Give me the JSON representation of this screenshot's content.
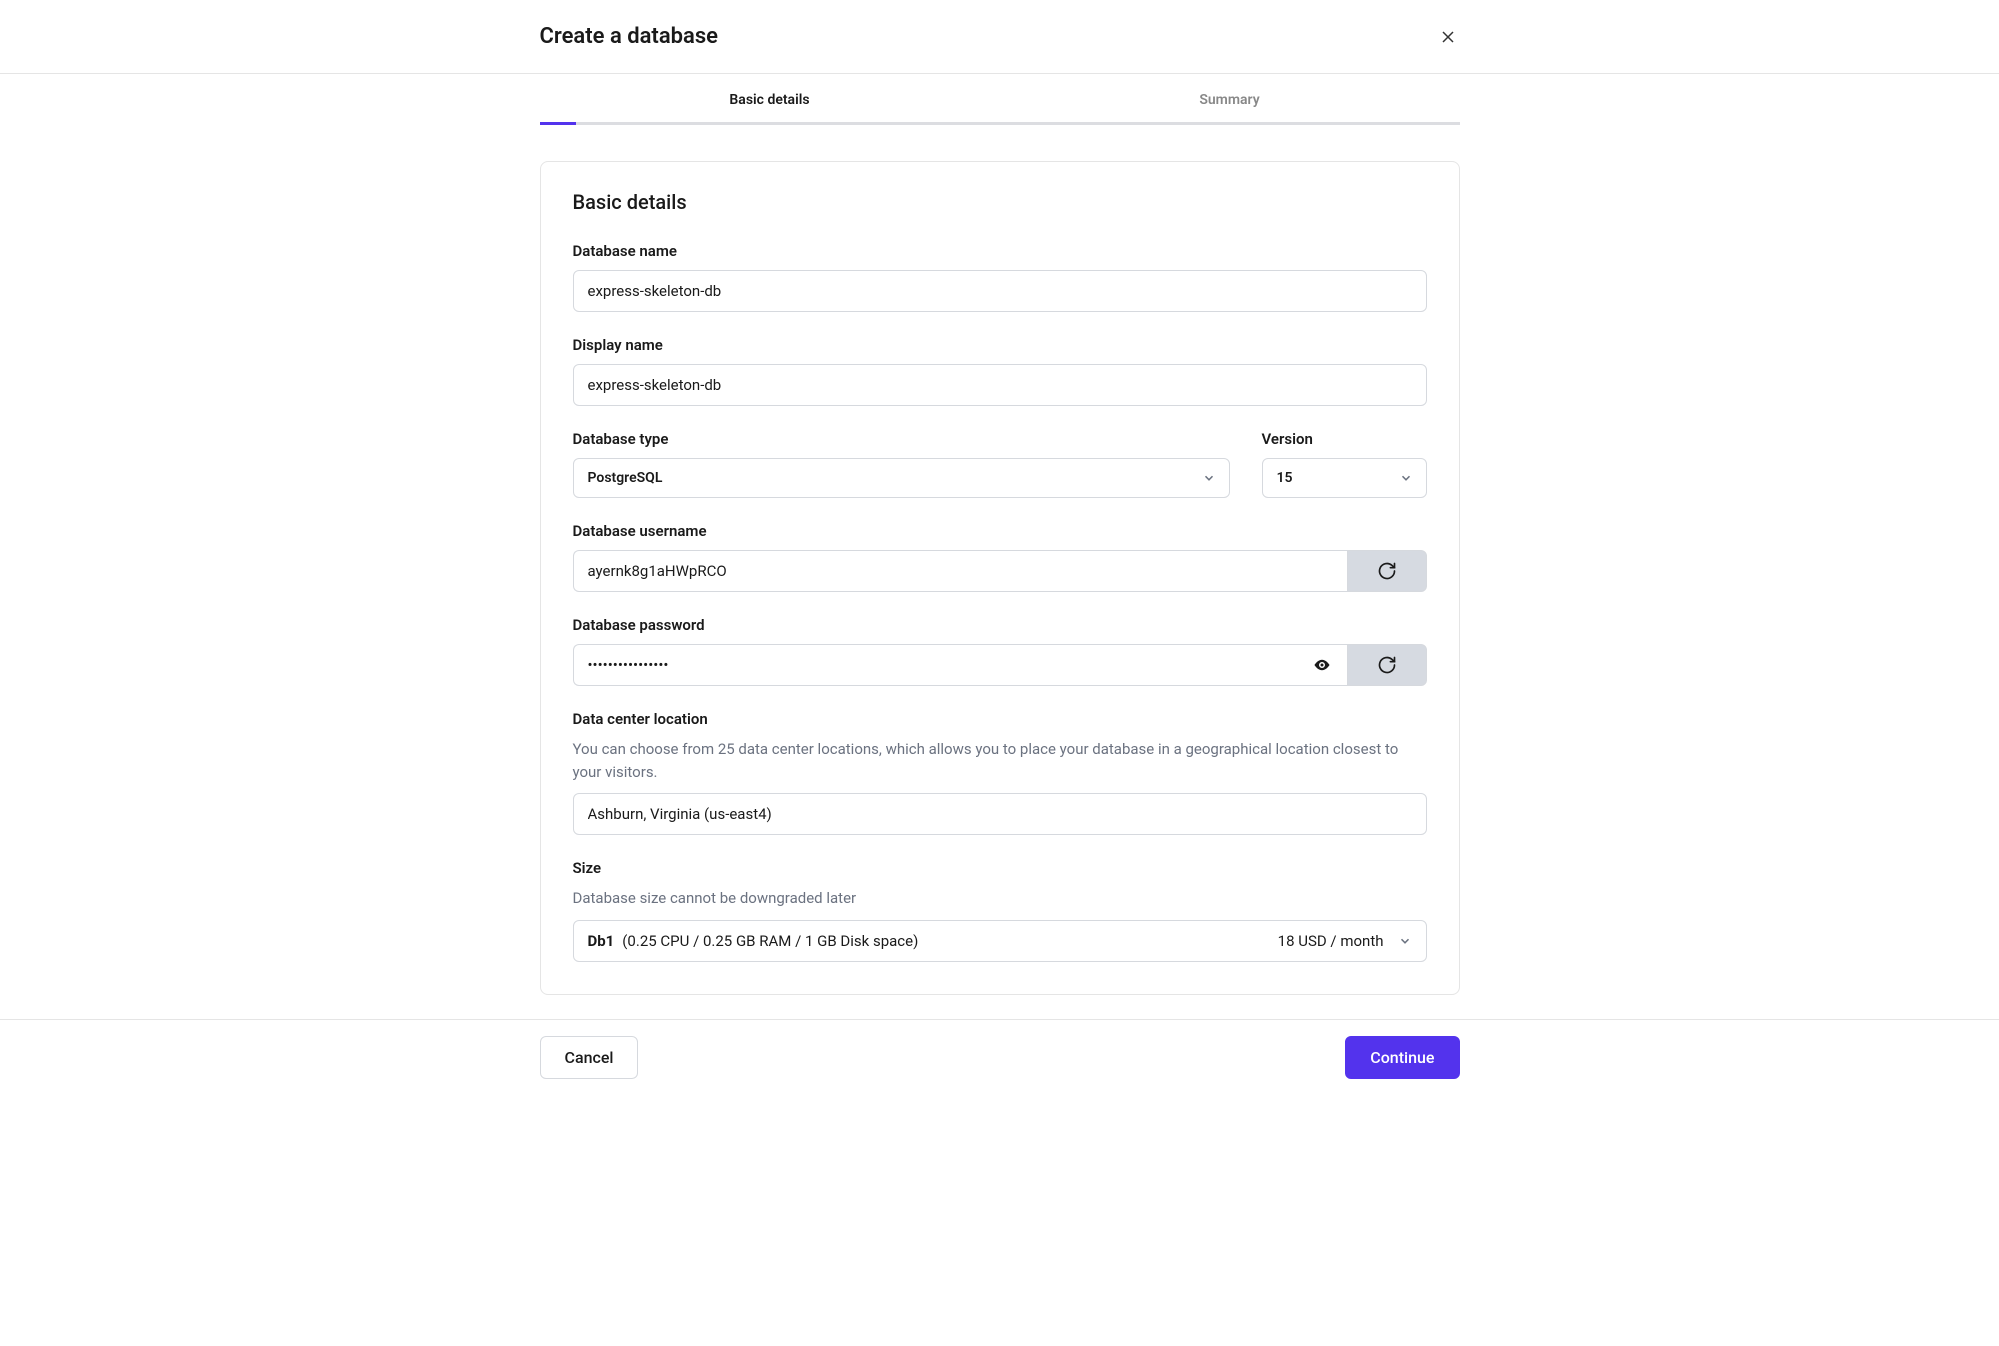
{
  "header": {
    "title": "Create a database"
  },
  "tabs": {
    "basic_details": "Basic details",
    "summary": "Summary"
  },
  "section": {
    "heading": "Basic details"
  },
  "fields": {
    "db_name": {
      "label": "Database name",
      "value": "express-skeleton-db"
    },
    "display_name": {
      "label": "Display name",
      "value": "express-skeleton-db"
    },
    "db_type": {
      "label": "Database type",
      "value": "PostgreSQL"
    },
    "version": {
      "label": "Version",
      "value": "15"
    },
    "db_username": {
      "label": "Database username",
      "value": "ayernk8g1aHWpRCO"
    },
    "db_password": {
      "label": "Database password",
      "value": "••••••••••••••••"
    },
    "location": {
      "label": "Data center location",
      "helper": "You can choose from 25 data center locations, which allows you to place your database in a geographical location closest to your visitors.",
      "value": "Ashburn, Virginia (us-east4)"
    },
    "size": {
      "label": "Size",
      "helper": "Database size cannot be downgraded later",
      "name": "Db1",
      "spec": "(0.25 CPU / 0.25 GB RAM / 1 GB Disk space)",
      "price": "18 USD / month"
    }
  },
  "footer": {
    "cancel": "Cancel",
    "continue": "Continue"
  }
}
